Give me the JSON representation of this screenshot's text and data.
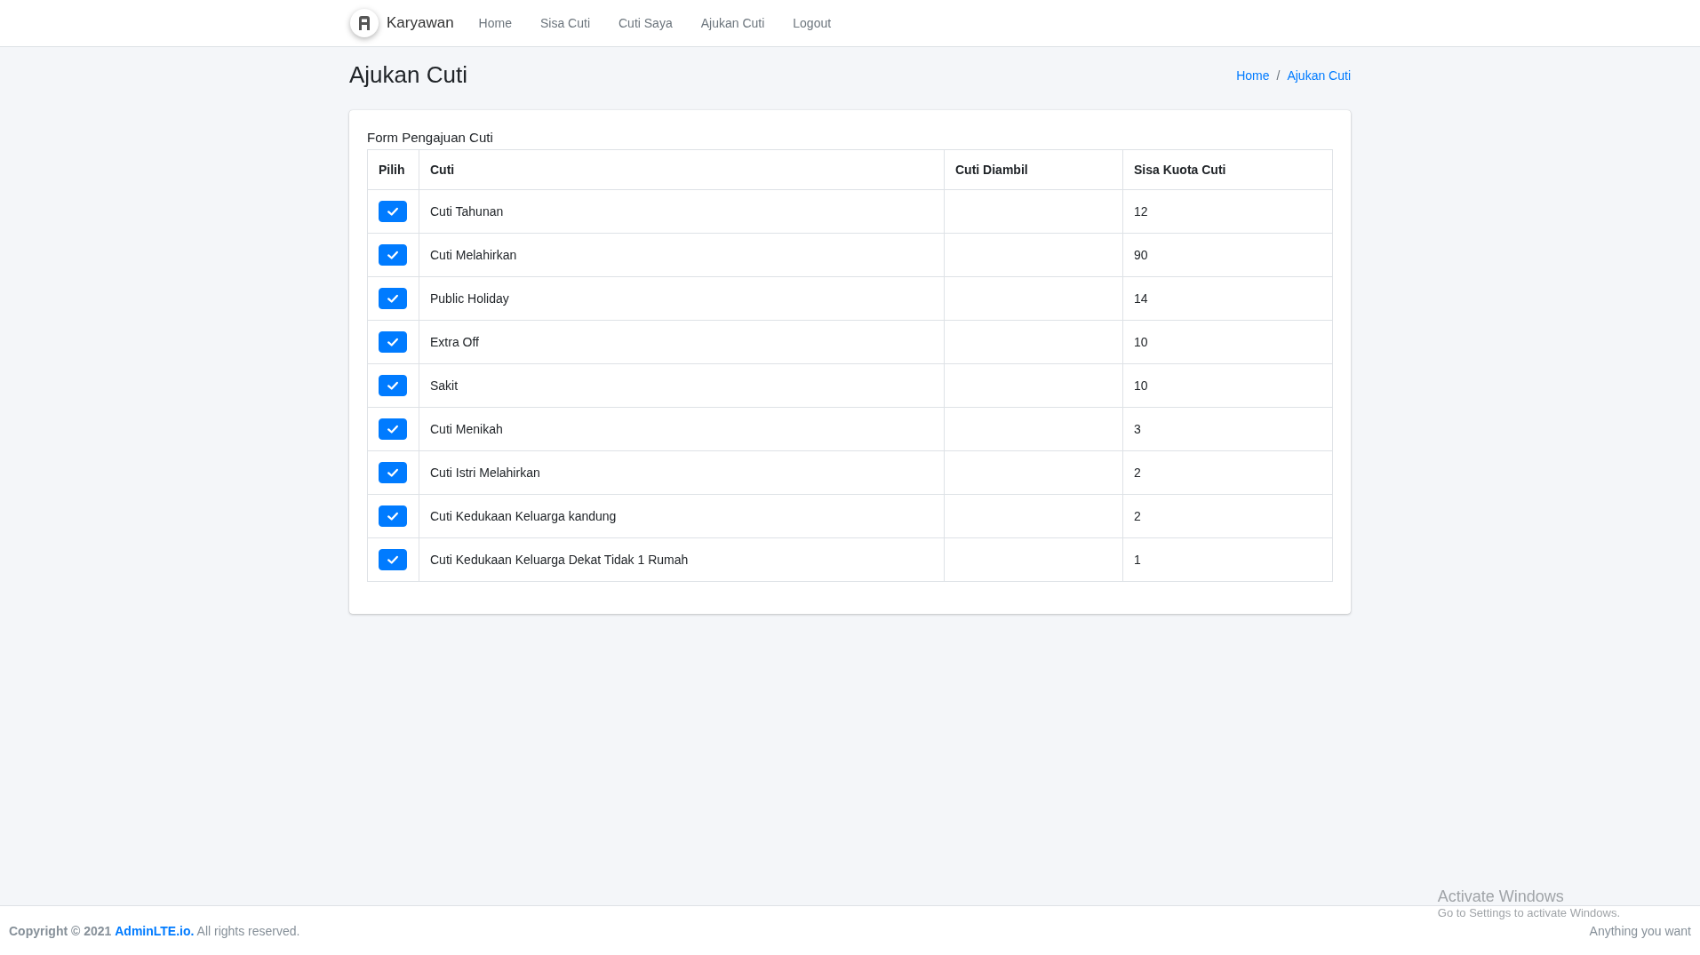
{
  "navbar": {
    "brand": "Karyawan",
    "links": [
      {
        "label": "Home",
        "selected": false
      },
      {
        "label": "Sisa Cuti",
        "selected": false
      },
      {
        "label": "Cuti Saya",
        "selected": false
      },
      {
        "label": "Ajukan Cuti",
        "selected": false
      },
      {
        "label": "Logout",
        "selected": false
      }
    ]
  },
  "page_title": "Ajukan Cuti",
  "breadcrumb": {
    "separator": "/",
    "items": [
      "Home",
      "Ajukan Cuti"
    ]
  },
  "card": {
    "title": "Form Pengajuan Cuti",
    "table": {
      "columns": [
        "Pilih",
        "Cuti",
        "Cuti Diambil",
        "Sisa Kuota Cuti"
      ],
      "rows": [
        {
          "checked": true,
          "cuti": "Cuti Tahunan",
          "sisa": "12"
        },
        {
          "checked": true,
          "cuti": "Cuti Melahirkan",
          "sisa": "90"
        },
        {
          "checked": true,
          "cuti": "Public Holiday",
          "sisa": "14"
        },
        {
          "checked": true,
          "cuti": "Extra Off",
          "sisa": "10"
        },
        {
          "checked": true,
          "cuti": "Sakit",
          "sisa": "10"
        },
        {
          "checked": true,
          "cuti": "Cuti Menikah",
          "sisa": "3"
        },
        {
          "checked": true,
          "cuti": "Cuti Istri Melahirkan",
          "sisa": "2"
        },
        {
          "checked": true,
          "cuti": "Cuti Kedukaan Keluarga kandung",
          "sisa": "2"
        },
        {
          "checked": true,
          "cuti": "Cuti Kedukaan Keluarga Dekat Tidak 1 Rumah",
          "sisa": "1"
        }
      ]
    }
  },
  "footer": {
    "copyright": "Copyright © 2021",
    "link": "AdminLTE.io.",
    "rights": "All rights reserved.",
    "right_text": "Anything you want"
  },
  "windows_notice": {
    "title": "Activate Windows",
    "subtitle": "Go to Settings to activate Windows."
  }
}
